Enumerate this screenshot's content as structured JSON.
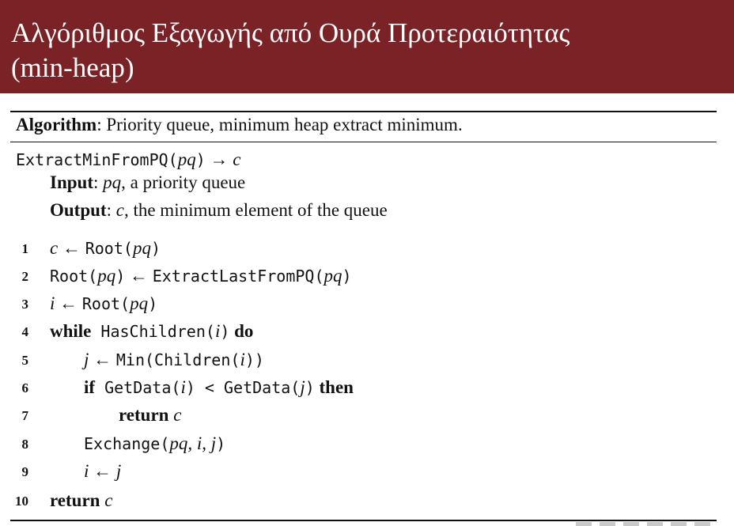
{
  "slide": {
    "title_line1": "Αλγόριθμος Εξαγωγής από Ουρά Προτεραιότητας",
    "title_line2": "(min-heap)"
  },
  "algorithm": {
    "label": "Algorithm",
    "caption": ": Priority queue, minimum heap extract minimum.",
    "signature": {
      "name": "ExtractMinFromPQ(",
      "param": "pq",
      "close": ")",
      "arrow": " → ",
      "ret": "c"
    },
    "input": {
      "label": "Input",
      "sep": ": ",
      "param": "pq",
      "desc": ", a priority queue"
    },
    "output": {
      "label": "Output",
      "sep": ": ",
      "param": "c",
      "desc": ", the minimum element of the queue"
    },
    "lines": [
      {
        "num": "1",
        "parts": {
          "a": "c",
          "b": " ← ",
          "c": "Root(",
          "d": "pq",
          "e": ")"
        }
      },
      {
        "num": "2",
        "parts": {
          "a": "Root(",
          "b": "pq",
          "c": ")",
          "d": " ← ",
          "e": "ExtractLastFromPQ(",
          "f": "pq",
          "g": ")"
        }
      },
      {
        "num": "3",
        "parts": {
          "a": "i",
          "b": " ← ",
          "c": "Root(",
          "d": "pq",
          "e": ")"
        }
      },
      {
        "num": "4",
        "parts": {
          "a": "while",
          "b": " HasChildren(",
          "c": "i",
          "d": ")",
          "e": " do"
        }
      },
      {
        "num": "5",
        "parts": {
          "a": "j",
          "b": " ← ",
          "c": "Min(Children(",
          "d": "i",
          "e": "))"
        }
      },
      {
        "num": "6",
        "parts": {
          "a": "if",
          "b": " GetData(",
          "c": "i",
          "d": ") < GetData(",
          "e": "j",
          "f": ")",
          "g": " then"
        }
      },
      {
        "num": "7",
        "parts": {
          "a": "return",
          "b": " c"
        }
      },
      {
        "num": "8",
        "parts": {
          "a": "Exchange(",
          "b": "pq, i, j",
          "c": ")"
        }
      },
      {
        "num": "9",
        "parts": {
          "a": "i",
          "b": " ← ",
          "c": "j"
        }
      },
      {
        "num": "10",
        "parts": {
          "a": "return",
          "b": " c"
        }
      }
    ]
  }
}
